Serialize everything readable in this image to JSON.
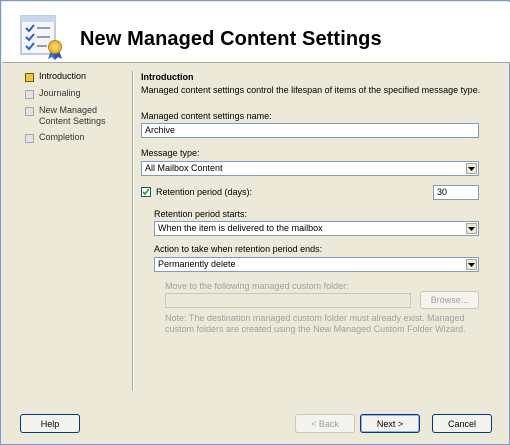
{
  "header": {
    "title": "New Managed Content Settings"
  },
  "nav": {
    "items": [
      {
        "label": "Introduction",
        "active": true
      },
      {
        "label": "Journaling",
        "active": false
      },
      {
        "label": "New Managed Content Settings",
        "active": false
      },
      {
        "label": "Completion",
        "active": false
      }
    ]
  },
  "intro": {
    "title": "Introduction",
    "description": "Managed content settings control the lifespan of items of the specified message type."
  },
  "form": {
    "name_label": "Managed content settings name:",
    "name_value": "Archive",
    "message_type_label": "Message type:",
    "message_type_value": "All Mailbox Content",
    "retention_label": "Retention period (days):",
    "retention_checked": true,
    "retention_value": "30",
    "starts_label": "Retention period starts:",
    "starts_value": "When the item is delivered to the mailbox",
    "action_label": "Action to take when retention period ends:",
    "action_value": "Permanently delete",
    "move_label": "Move to the following managed custom folder:",
    "move_value": "",
    "browse_label": "Browse...",
    "note": "Note: The destination managed custom folder must already exist. Managed custom folders are created using the New Managed Custom Folder Wizard."
  },
  "footer": {
    "help_label": "Help",
    "back_label": "< Back",
    "next_label": "Next >",
    "cancel_label": "Cancel"
  }
}
